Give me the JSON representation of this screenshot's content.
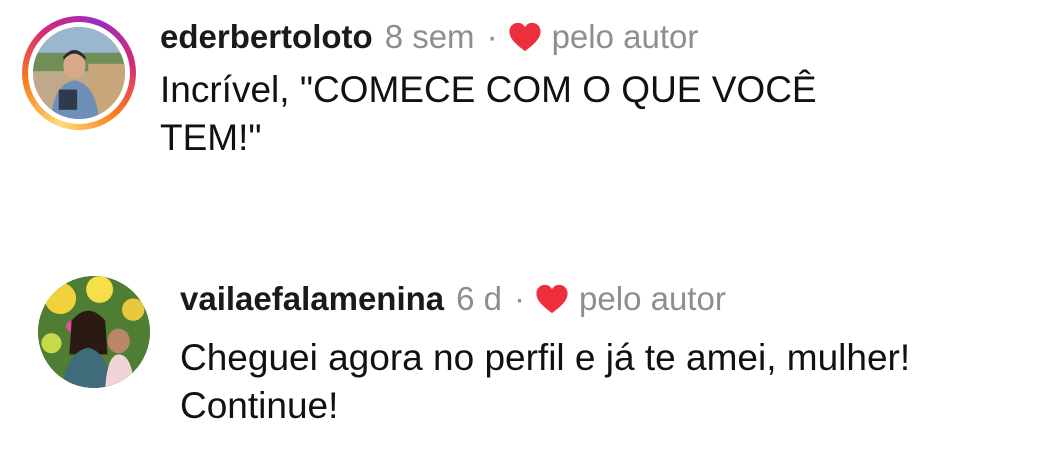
{
  "comments": [
    {
      "username": "ederbertoloto",
      "time": "8 sem",
      "separator": "·",
      "liked_by_author_label": "pelo autor",
      "text": "Incrível, \"COMECE COM O QUE VOCÊ TEM!\"",
      "avatar": "profile-photo-with-story-ring"
    },
    {
      "username": "vailaefalamenina",
      "time": "6 d",
      "separator": "·",
      "liked_by_author_label": "pelo autor",
      "text": "Cheguei agora no perfil e já te amei, mulher! Continue!",
      "avatar": "profile-photo"
    }
  ],
  "colors": {
    "heart": "#ed2e3c",
    "meta_gray": "#8e8e8e",
    "text": "#111111"
  },
  "icons": {
    "liked_by_author": "heart-icon"
  }
}
